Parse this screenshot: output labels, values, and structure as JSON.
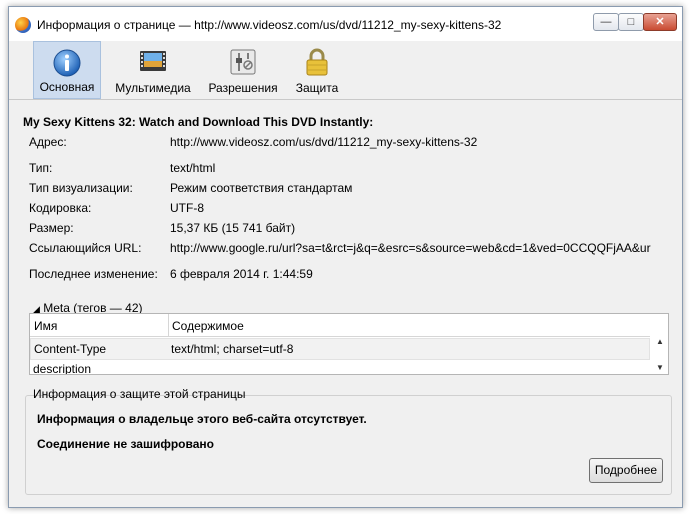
{
  "window": {
    "title": "Информация о странице — http://www.videosz.com/us/dvd/11212_my-sexy-kittens-32",
    "controls": {
      "minimize": "—",
      "maximize": "□",
      "close": "✕"
    }
  },
  "toolbar": {
    "tabs": [
      {
        "label": "Основная",
        "icon": "info-icon",
        "active": true
      },
      {
        "label": "Мультимедиа",
        "icon": "media-icon",
        "active": false
      },
      {
        "label": "Разрешения",
        "icon": "permissions-icon",
        "active": false
      },
      {
        "label": "Защита",
        "icon": "lock-icon",
        "active": false
      }
    ]
  },
  "general": {
    "page_title": "My Sexy Kittens 32: Watch and Download This DVD Instantly:",
    "fields": [
      {
        "label": "Адрес:",
        "value": "http://www.videosz.com/us/dvd/11212_my-sexy-kittens-32"
      },
      {
        "label": "Тип:",
        "value": "text/html"
      },
      {
        "label": "Тип визуализации:",
        "value": "Режим соответствия стандартам"
      },
      {
        "label": "Кодировка:",
        "value": "UTF-8"
      },
      {
        "label": "Размер:",
        "value": "15,37 КБ (15 741 байт)"
      },
      {
        "label": "Ссылающийся URL:",
        "value": "http://www.google.ru/url?sa=t&rct=j&q=&esrc=s&source=web&cd=1&ved=0CCQQFjAA&ur"
      },
      {
        "label": "Последнее изменение:",
        "value": "6 февраля 2014 г. 1:44:59"
      }
    ]
  },
  "meta": {
    "legend": "Meta (тегов — 42)",
    "columns": [
      "Имя",
      "Содержимое"
    ],
    "rows": [
      {
        "name": "Content-Type",
        "content": "text/html; charset=utf-8"
      },
      {
        "name": "description",
        "content": ""
      }
    ]
  },
  "security": {
    "legend": "Информация о защите этой страницы",
    "owner_text": "Информация о владельце этого веб-сайта отсутствует.",
    "connection_text": "Соединение не зашифровано",
    "details_button": "Подробнее"
  },
  "colors": {
    "active_tab_bg": "#cddcef",
    "window_bg": "#f0f0f0",
    "close_button": "#c94b32"
  }
}
